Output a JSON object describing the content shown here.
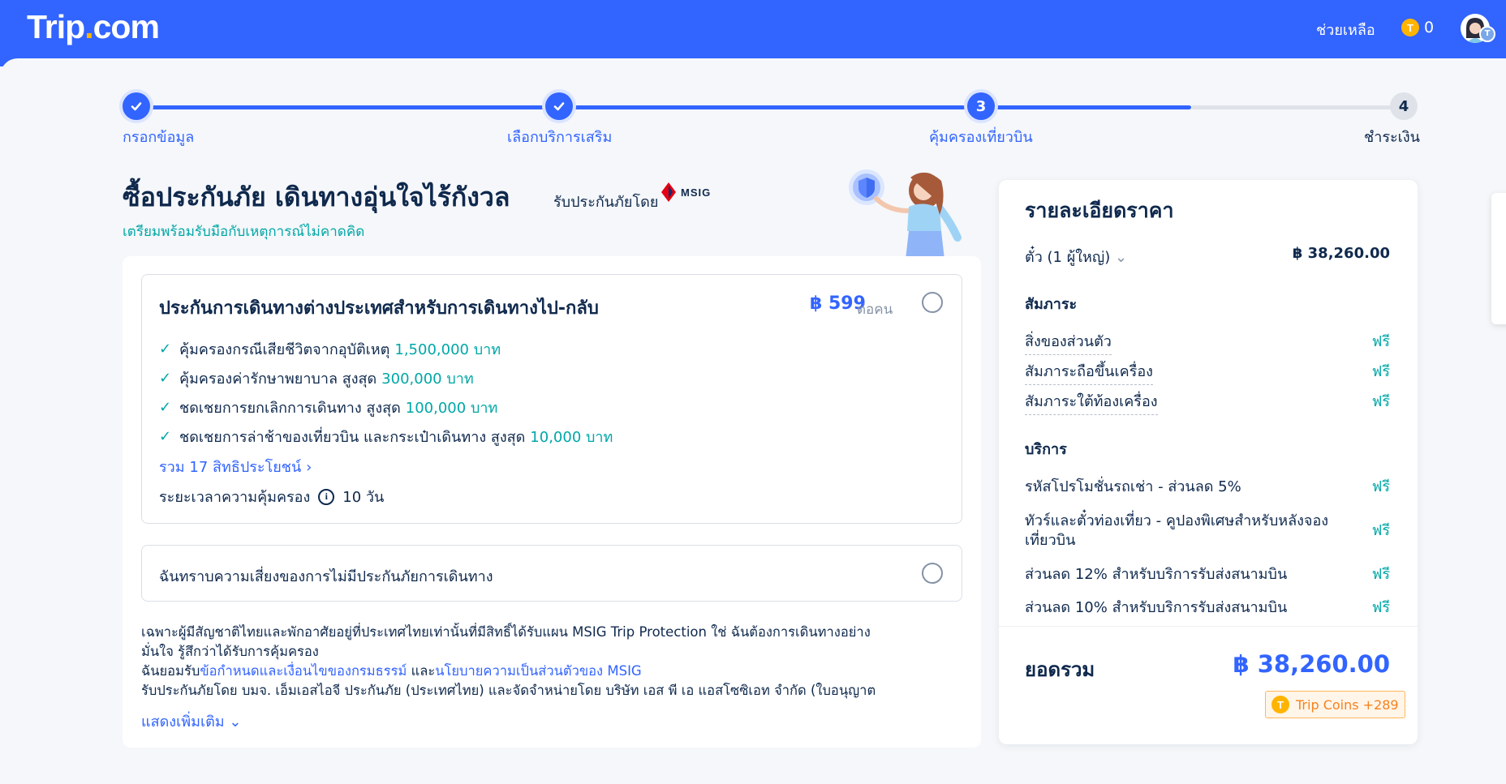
{
  "header": {
    "logo_main": "Trip",
    "logo_dot": ".",
    "logo_tail": "com",
    "help_label": "ช่วยเหลือ",
    "coin_icon": "T",
    "coin_count": "0",
    "avatar_badge": "T"
  },
  "stepper": {
    "steps": [
      {
        "label": "กรอกข้อมูล",
        "status": "done"
      },
      {
        "label": "เลือกบริการเสริม",
        "status": "done"
      },
      {
        "label": "คุ้มครองเที่ยวบิน",
        "number": "3",
        "status": "current"
      },
      {
        "label": "ชำระเงิน",
        "number": "4",
        "status": "todo"
      }
    ]
  },
  "insurance": {
    "title": "ซื้อประกันภัย เดินทางอุ่นใจไร้กังวล",
    "insured_by": "รับประกันภัยโดย",
    "insurer_logo": "MSIG",
    "subtitle": "เตรียมพร้อมรับมือกับเหตุการณ์ไม่คาดคิด",
    "plan": {
      "title": "ประกันการเดินทางต่างประเทศสำหรับการเดินทางไป-กลับ",
      "price": "฿ 599",
      "price_unit": "ต่อคน",
      "benefits": [
        {
          "text": "คุ้มครองกรณีเสียชีวิตจากอุบัติเหตุ",
          "amount": "1,500,000 บาท"
        },
        {
          "text": "คุ้มครองค่ารักษาพยาบาล สูงสุด",
          "amount": "300,000 บาท"
        },
        {
          "text": "ชดเชยการยกเลิกการเดินทาง สูงสุด",
          "amount": "100,000 บาท"
        },
        {
          "text": "ชดเชยการล่าช้าของเที่ยวบิน และกระเป๋าเดินทาง สูงสุด",
          "amount": "10,000 บาท"
        }
      ],
      "all_benefits_link": "รวม 17 สิทธิประโยชน์",
      "duration_label": "ระยะเวลาความคุ้มครอง",
      "duration_value": "10 วัน"
    },
    "no_insurance_option": "ฉันทราบความเสี่ยงของการไม่มีประกันภัยการเดินทาง",
    "disclaimer": {
      "line1": "เฉพาะผู้มีสัญชาติไทยและพักอาศัยอยู่ที่ประเทศไทยเท่านั้นที่มีสิทธิ์ได้รับแผน MSIG Trip Protection ใช่ ฉันต้องการเดินทางอย่าง",
      "line2": "มั่นใจ รู้สึกว่าได้รับการคุ้มครอง",
      "line3_prefix": "ฉันยอมรับ",
      "line3_link1": "ข้อกำหนดและเงื่อนไขของกรมธรรม์",
      "line3_and": " และ",
      "line3_link2": "นโยบายความเป็นส่วนตัวของ MSIG",
      "line4": "รับประกันภัยโดย บมจ. เอ็มเอสไอจี ประกันภัย (ประเทศไทย) และจัดจำหน่ายโดย บริษัท เอส พี เอ แอสโซซิเอท จำกัด (ใบอนุญาต"
    },
    "show_more": "แสดงเพิ่มเติม"
  },
  "price_details": {
    "title": "รายละเอียดราคา",
    "ticket_label": "ตั๋ว (1 ผู้ใหญ่)",
    "ticket_price": "฿ 38,260.00",
    "baggage_section": "สัมภาระ",
    "baggage_items": [
      {
        "label": "สิ่งของส่วนตัว",
        "value": "ฟรี"
      },
      {
        "label": "สัมภาระถือขึ้นเครื่อง",
        "value": "ฟรี"
      },
      {
        "label": "สัมภาระใต้ท้องเครื่อง",
        "value": "ฟรี"
      }
    ],
    "services_section": "บริการ",
    "service_items": [
      {
        "label": "รหัสโปรโมชั่นรถเช่า - ส่วนลด 5%",
        "value": "ฟรี"
      },
      {
        "label": "ทัวร์และตั๋วท่องเที่ยว - คูปองพิเศษสำหรับหลังจอง",
        "label2": "เที่ยวบิน",
        "value": "ฟรี"
      },
      {
        "label": "ส่วนลด 12% สำหรับบริการรับส่งสนามบิน",
        "value": "ฟรี"
      },
      {
        "label": "ส่วนลด 10% สำหรับบริการรับส่งสนามบิน",
        "value": "ฟรี"
      }
    ],
    "total_label": "ยอดรวม",
    "total_value": "฿ 38,260.00",
    "trip_coins": "Trip Coins +289"
  },
  "colors": {
    "brand_blue": "#3264ff",
    "teal": "#00a7a7",
    "coin_gold": "#ffb400",
    "coin_orange": "#f5821f"
  }
}
